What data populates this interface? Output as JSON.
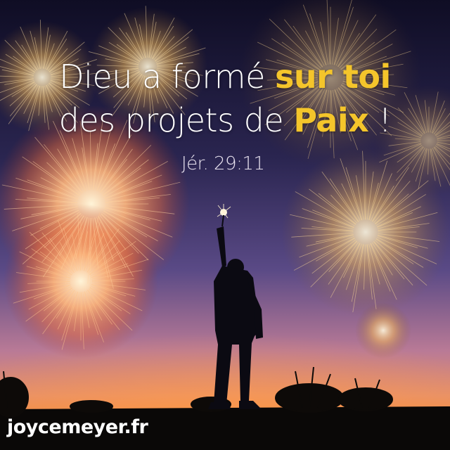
{
  "quote": {
    "line1_plain": "Dieu a formé ",
    "line1_highlight": "sur toi",
    "line2_plain": "des projets de ",
    "line2_highlight": "Paix",
    "line2_end": " !",
    "highlight_color": "#f4c52b"
  },
  "reference": "Jér. 29:11",
  "brand": "joycemeyer.fr"
}
